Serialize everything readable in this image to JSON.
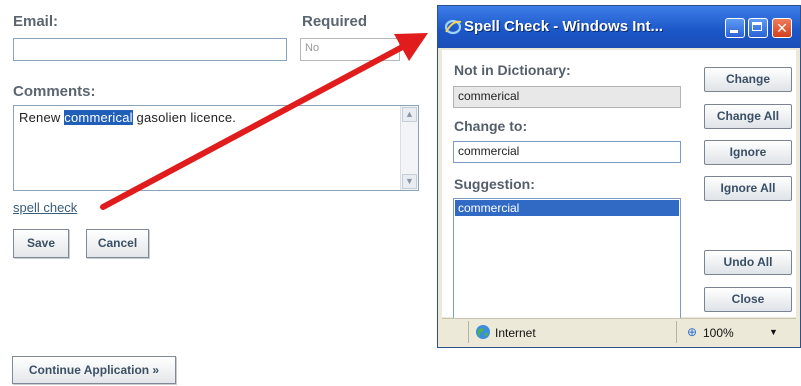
{
  "form": {
    "email_label": "Email:",
    "email_value": "",
    "required_label": "Required",
    "required_value": "No",
    "comments_label": "Comments:",
    "comment_before": "Renew ",
    "comment_highlight": "commerical",
    "comment_after": " gasolien licence.",
    "spell_check_link": "spell check",
    "save_label": "Save",
    "cancel_label": "Cancel",
    "continue_label": "Continue Application »"
  },
  "popup": {
    "title": "Spell Check - Windows Int...",
    "not_in_dictionary_label": "Not in Dictionary:",
    "not_in_dictionary_value": "commerical",
    "change_to_label": "Change to:",
    "change_to_value": "commercial",
    "suggestion_label": "Suggestion:",
    "suggestions": [
      "commercial"
    ],
    "buttons": {
      "change": "Change",
      "change_all": "Change All",
      "ignore": "Ignore",
      "ignore_all": "Ignore All",
      "undo_all": "Undo All",
      "close": "Close"
    },
    "status": {
      "zone": "Internet",
      "zoom": "100%"
    }
  },
  "colors": {
    "annotation_arrow": "#e01c1c",
    "highlight": "#1f5fb8",
    "titlebar": "#1b56c7"
  }
}
